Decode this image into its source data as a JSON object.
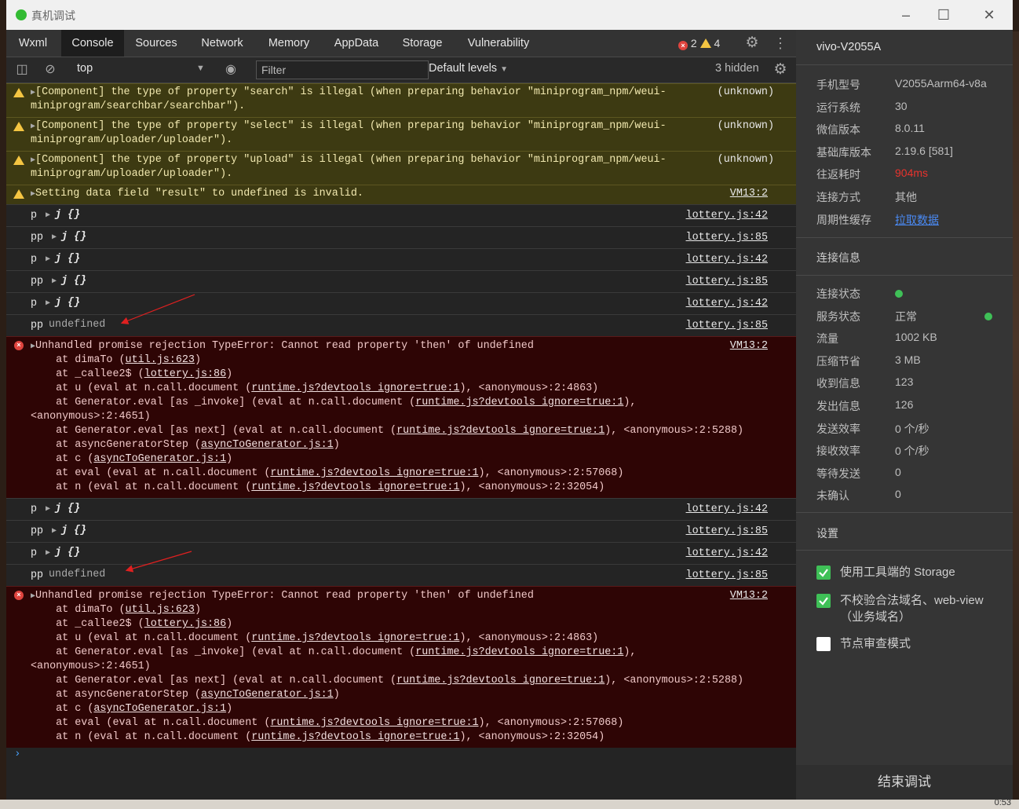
{
  "window": {
    "title": "真机调试"
  },
  "tabs": [
    "Wxml",
    "Console",
    "Sources",
    "Network",
    "Memory",
    "AppData",
    "Storage",
    "Vulnerability"
  ],
  "counts": {
    "errors": "2",
    "warnings": "4"
  },
  "toolbar": {
    "context": "top",
    "filter_placeholder": "Filter",
    "levels": "Default levels",
    "hidden": "3 hidden"
  },
  "console": {
    "warnings": [
      {
        "l1": "[Component] the type of property \"search\" is illegal (when preparing behavior \"miniprogram_npm/weui-",
        "l2": "miniprogram/searchbar/searchbar\").",
        "src": "(unknown)"
      },
      {
        "l1": "[Component] the type of property \"select\" is illegal (when preparing behavior \"miniprogram_npm/weui-",
        "l2": "miniprogram/uploader/uploader\").",
        "src": "(unknown)"
      },
      {
        "l1": "[Component] the type of property \"upload\" is illegal (when preparing behavior \"miniprogram_npm/weui-",
        "l2": "miniprogram/uploader/uploader\").",
        "src": "(unknown)"
      },
      {
        "l1": "Setting data field \"result\" to undefined is invalid.",
        "src": "VM13:2"
      }
    ],
    "logs1": [
      {
        "label": "p",
        "value": "j {}",
        "src": "lottery.js:42"
      },
      {
        "label": "pp",
        "value": "j {}",
        "src": "lottery.js:85"
      },
      {
        "label": "p",
        "value": "j {}",
        "src": "lottery.js:42"
      },
      {
        "label": "pp",
        "value": "j {}",
        "src": "lottery.js:85"
      },
      {
        "label": "p",
        "value": "j {}",
        "src": "lottery.js:42"
      },
      {
        "label": "pp",
        "value": "undefined",
        "src": "lottery.js:85"
      }
    ],
    "logs2": [
      {
        "label": "p",
        "value": "j {}",
        "src": "lottery.js:42"
      },
      {
        "label": "pp",
        "value": "j {}",
        "src": "lottery.js:85"
      },
      {
        "label": "p",
        "value": "j {}",
        "src": "lottery.js:42"
      },
      {
        "label": "pp",
        "value": "undefined",
        "src": "lottery.js:85"
      }
    ],
    "error": {
      "message": "Unhandled promise rejection TypeError: Cannot read property 'then' of undefined",
      "src": "VM13:2",
      "stack": [
        {
          "pre": "    at dimaTo (",
          "link": "util.js:623",
          "post": ")"
        },
        {
          "pre": "    at _callee2$ (",
          "link": "lottery.js:86",
          "post": ")"
        },
        {
          "pre": "    at u (eval at n.call.document (",
          "link": "runtime.js?devtools_ignore=true:1",
          "post": "), <anonymous>:2:4863)"
        },
        {
          "pre": "    at Generator.eval [as _invoke] (eval at n.call.document (",
          "link": "runtime.js?devtools_ignore=true:1",
          "post": "),"
        },
        {
          "pre": "<anonymous>:2:4651)",
          "link": "",
          "post": ""
        },
        {
          "pre": "    at Generator.eval [as next] (eval at n.call.document (",
          "link": "runtime.js?devtools_ignore=true:1",
          "post": "), <anonymous>:2:5288)"
        },
        {
          "pre": "    at asyncGeneratorStep (",
          "link": "asyncToGenerator.js:1",
          "post": ")"
        },
        {
          "pre": "    at c (",
          "link": "asyncToGenerator.js:1",
          "post": ")"
        },
        {
          "pre": "    at eval (eval at n.call.document (",
          "link": "runtime.js?devtools_ignore=true:1",
          "post": "), <anonymous>:2:57068)"
        },
        {
          "pre": "    at n (eval at n.call.document (",
          "link": "runtime.js?devtools_ignore=true:1",
          "post": "), <anonymous>:2:32054)"
        }
      ]
    }
  },
  "panel": {
    "device": "vivo-V2055A",
    "info": [
      {
        "k": "手机型号",
        "v": "V2055Aarm64-v8a"
      },
      {
        "k": "运行系统",
        "v": "30"
      },
      {
        "k": "微信版本",
        "v": "8.0.11"
      },
      {
        "k": "基础库版本",
        "v": "2.19.6 [581]"
      },
      {
        "k": "往返耗时",
        "v": "904ms"
      },
      {
        "k": "连接方式",
        "v": "其他"
      },
      {
        "k": "周期性缓存",
        "v": "拉取数据"
      }
    ],
    "conn_title": "连接信息",
    "conn": [
      {
        "k": "连接状态",
        "v": ""
      },
      {
        "k": "服务状态",
        "v": "正常"
      },
      {
        "k": "流量",
        "v": "1002 KB"
      },
      {
        "k": "压缩节省",
        "v": "3 MB"
      },
      {
        "k": "收到信息",
        "v": "123"
      },
      {
        "k": "发出信息",
        "v": "126"
      },
      {
        "k": "发送效率",
        "v": "0 个/秒"
      },
      {
        "k": "接收效率",
        "v": "0 个/秒"
      },
      {
        "k": "等待发送",
        "v": "0"
      },
      {
        "k": "未确认",
        "v": "0"
      }
    ],
    "settings_title": "设置",
    "settings": [
      {
        "label": "使用工具端的 Storage",
        "checked": true
      },
      {
        "label": "不校验合法域名、web-view（业务域名）",
        "checked": true
      },
      {
        "label": "节点审查模式",
        "checked": false
      }
    ],
    "end_button": "结束调试"
  },
  "colors": {
    "warn_bg": "#3d3a12",
    "error_bg": "#2e0505",
    "accent_red": "#e8332d",
    "status_green": "#3fc057",
    "link_blue": "#4a8af4"
  },
  "taskbar_text": "0:53"
}
